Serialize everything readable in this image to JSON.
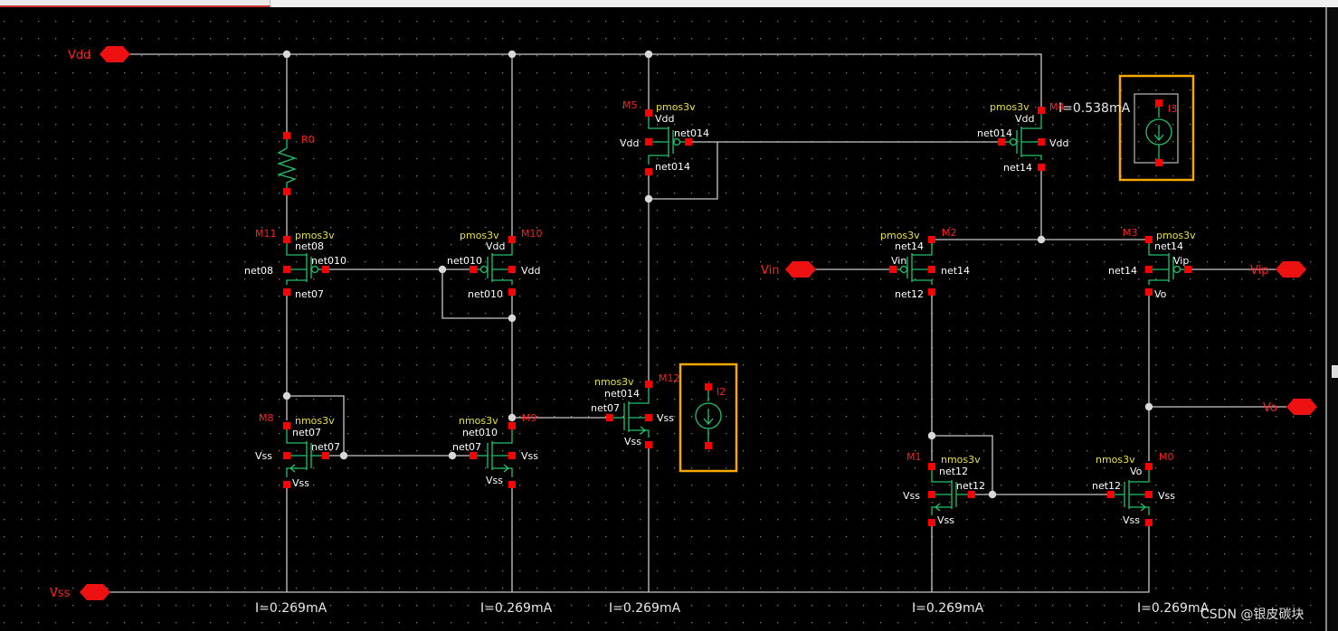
{
  "ports": {
    "vdd": "Vdd",
    "vss": "Vss",
    "vin": "Vin",
    "vip": "Vip",
    "vo": "Vo"
  },
  "resistor": {
    "name": "R0"
  },
  "sources": {
    "i3": {
      "name": "I3",
      "value": "I=0.538mA"
    },
    "i2": {
      "name": "I2"
    }
  },
  "devices": {
    "m11": {
      "name": "M11",
      "model": "pmos3v",
      "d": "net08",
      "g": "net010",
      "gl": "net08",
      "s": "net07"
    },
    "m10": {
      "name": "M10",
      "model": "pmos3v",
      "d": "Vdd",
      "g": "net010",
      "sl": "Vdd",
      "s": "net010"
    },
    "m5": {
      "name": "M5",
      "model": "pmos3v",
      "d": "Vdd",
      "gl": "Vdd",
      "g": "net014",
      "s": "net014"
    },
    "m4": {
      "name": "M4",
      "model": "pmos3v",
      "d": "Vdd",
      "g": "net014",
      "sl": "Vdd",
      "s": "net14"
    },
    "m2": {
      "name": "M2",
      "model": "pmos3v",
      "d": "net14",
      "g": "Vin",
      "sl": "net14",
      "s": "net12"
    },
    "m3": {
      "name": "M3",
      "model": "pmos3v",
      "d": "net14",
      "gl": "net14",
      "g": "Vip",
      "s": "Vo"
    },
    "m8": {
      "name": "M8",
      "model": "nmos3v",
      "d": "net07",
      "gl": "Vss",
      "g": "net07",
      "s": "Vss"
    },
    "m9": {
      "name": "M9",
      "model": "nmos3v",
      "d": "net010",
      "g": "net07",
      "sl": "Vss",
      "s": "Vss"
    },
    "m12": {
      "name": "M12",
      "model": "nmos3v",
      "d": "net014",
      "g": "net07",
      "sl": "Vss",
      "s": "Vss"
    },
    "m1": {
      "name": "M1",
      "model": "nmos3v",
      "d": "net12",
      "gl": "Vss",
      "g": "net12",
      "s": "Vss"
    },
    "m0": {
      "name": "M0",
      "model": "nmos3v",
      "d": "Vo",
      "g": "net12",
      "sl": "Vss",
      "s": "Vss"
    }
  },
  "currents": [
    "I=0.269mA",
    "I=0.269mA",
    "I=0.269mA",
    "I=0.269mA",
    "I=0.269mA"
  ],
  "watermark": "CSDN @银皮碳块"
}
